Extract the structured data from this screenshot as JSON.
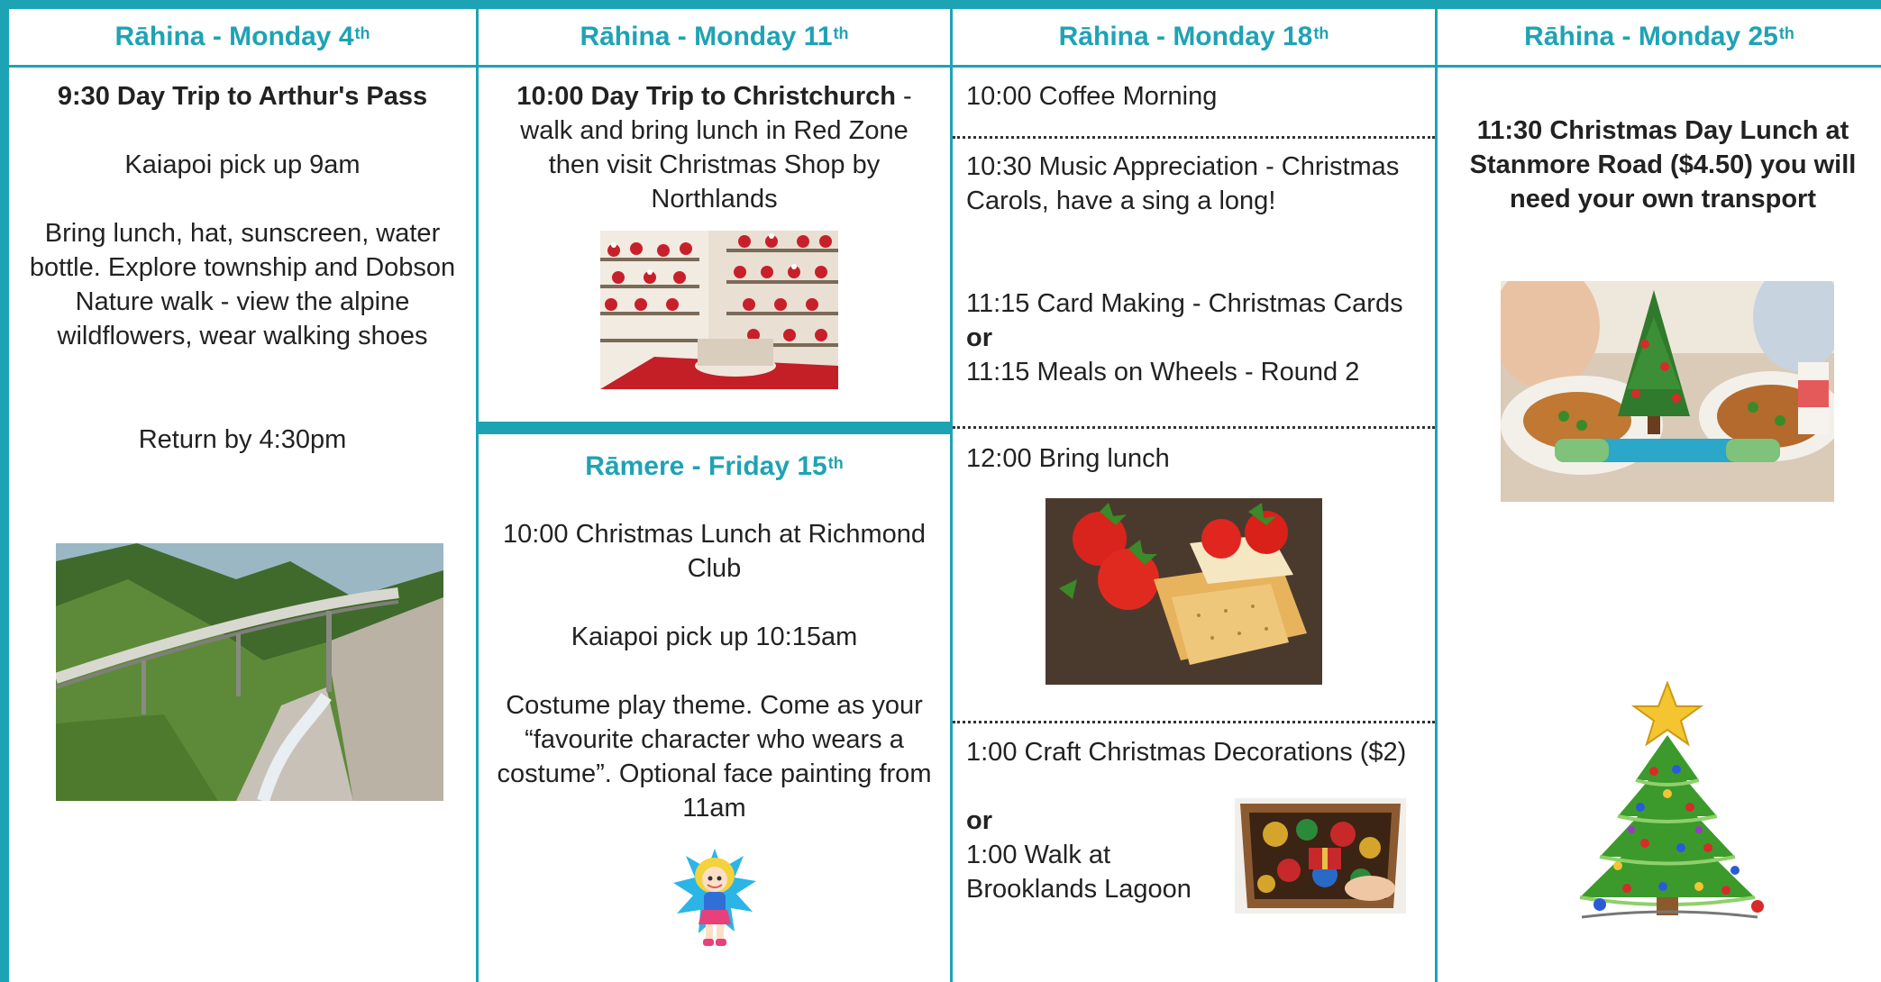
{
  "days": [
    {
      "day_label": "Rāhina - Monday 4",
      "suffix": "th"
    },
    {
      "day_label": "Rāhina - Monday 11",
      "suffix": "th"
    },
    {
      "day_label": "Rāhina - Monday 18",
      "suffix": "th"
    },
    {
      "day_label": "Rāhina - Monday 25",
      "suffix": "th"
    }
  ],
  "col1": {
    "title": "9:30 Day Trip to Arthur's Pass",
    "pickup": "Kaiapoi pick up 9am",
    "details": "Bring lunch, hat, sunscreen, water bottle. Explore township and Dobson Nature walk - view the alpine wildflowers, wear walking shoes",
    "return": "Return by 4:30pm"
  },
  "col2": {
    "title_bold": "10:00 Day Trip to Christchurch",
    "title_rest": " - walk and bring lunch in Red Zone then visit Christmas Shop by Northlands",
    "friday_label": "Rāmere - Friday 15",
    "friday_suffix": "th",
    "lunch": "10:00 Christmas Lunch at Richmond Club",
    "pickup": "Kaiapoi pick up 10:15am",
    "costume": "Costume play theme. Come as your “favourite character who wears a costume”. Optional face painting from 11am"
  },
  "col3": {
    "coffee": "10:00 Coffee Morning",
    "music": "10:30 Music Appreciation - Christmas Carols, have a sing a long!",
    "cards": "11:15 Card Making - Christmas Cards",
    "or1": "or",
    "meals": "11:15 Meals on Wheels - Round 2",
    "lunch": "12:00 Bring lunch",
    "craft": "1:00 Craft Christmas Decorations ($2)",
    "or2": "or",
    "walk": "1:00 Walk at Brooklands Lagoon"
  },
  "col4": {
    "lunch": "11:30 Christmas Day Lunch at Stanmore Road ($4.50) you will need your own transport"
  }
}
